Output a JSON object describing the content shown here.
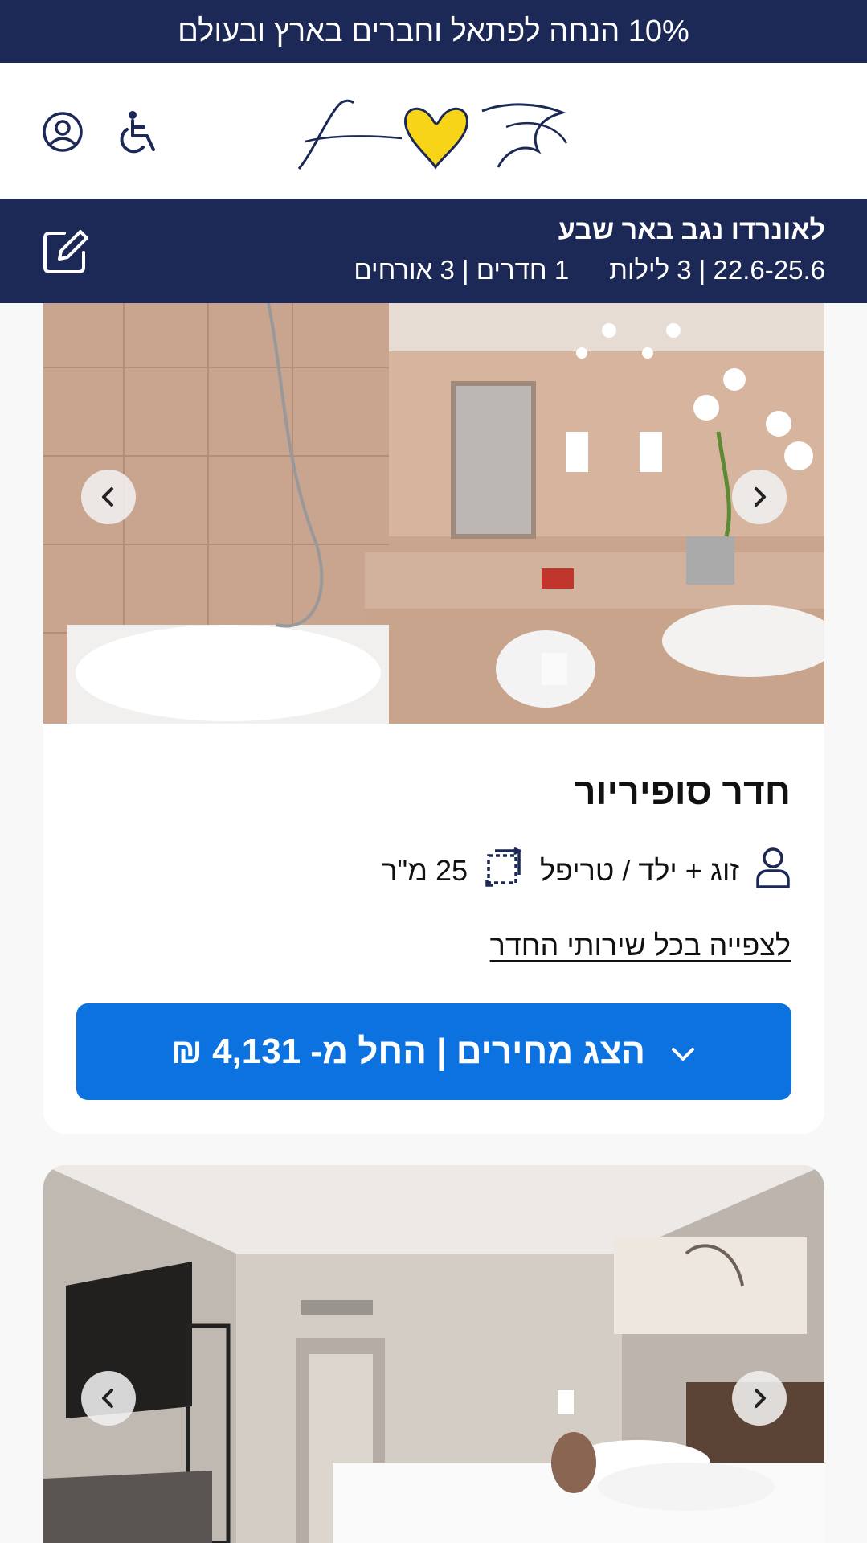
{
  "promo_banner": {
    "text": "10% הנחה לפתאל וחברים בארץ ובעולם"
  },
  "header": {
    "brand": {
      "logo_text_latin": "fattal",
      "logo_text_hebrew": "פתאל"
    },
    "icons": [
      "user-circle-icon",
      "accessibility-icon"
    ]
  },
  "booking_summary": {
    "hotel": "לאונרדו נגב באר שבע",
    "dates": "22.6-25.6 | 3 לילות",
    "rooms_guests": "1 חדרים | 3 אורחים",
    "edit_icon": "edit-icon"
  },
  "rooms": [
    {
      "photo": "bathroom",
      "name": "חדר סופיריור",
      "occupancy": "זוג + ילד / טריפל",
      "size": "25 מ\"ר",
      "details_link": "לצפייה בכל שירותי החדר",
      "price_button": "הצג מחירים | החל מ- 4,131 ₪"
    },
    {
      "photo": "bedroom"
    }
  ],
  "colors": {
    "navy": "#1c2855",
    "primary_blue": "#0b72e0",
    "logo_yellow": "#f7d417"
  }
}
